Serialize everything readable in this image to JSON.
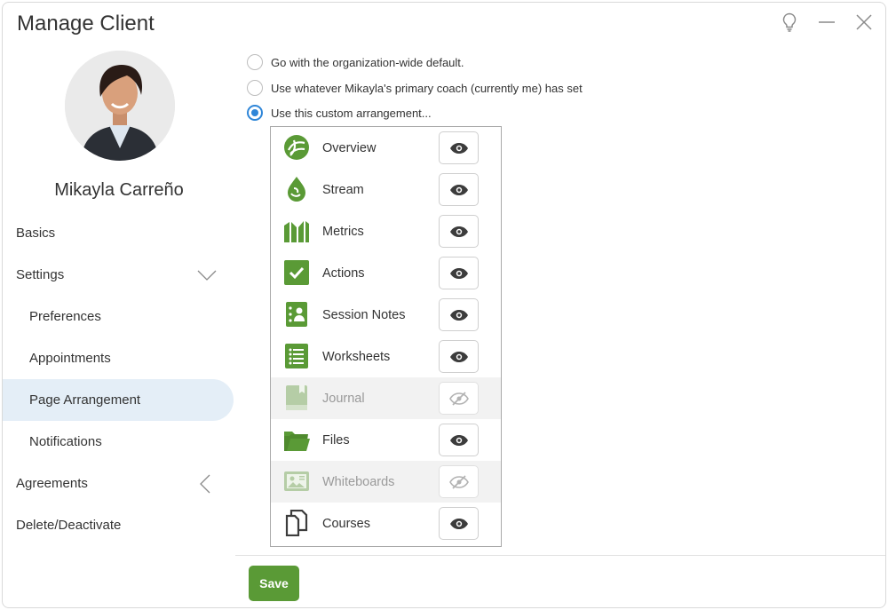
{
  "window": {
    "title": "Manage Client"
  },
  "client": {
    "name": "Mikayla Carreño"
  },
  "sidebar": {
    "items": [
      {
        "label": "Basics"
      },
      {
        "label": "Settings"
      },
      {
        "label": "Preferences"
      },
      {
        "label": "Appointments"
      },
      {
        "label": "Page Arrangement"
      },
      {
        "label": "Notifications"
      },
      {
        "label": "Agreements"
      },
      {
        "label": "Delete/Deactivate"
      }
    ],
    "active": "Page Arrangement"
  },
  "options": [
    {
      "label": "Go with the organization-wide default.",
      "checked": false
    },
    {
      "label": "Use whatever Mikayla's primary coach (currently me) has set",
      "checked": false
    },
    {
      "label": "Use this custom arrangement...",
      "checked": true
    }
  ],
  "arrangement": [
    {
      "label": "Overview",
      "icon": "overview-icon",
      "visible": true
    },
    {
      "label": "Stream",
      "icon": "stream-icon",
      "visible": true
    },
    {
      "label": "Metrics",
      "icon": "metrics-icon",
      "visible": true
    },
    {
      "label": "Actions",
      "icon": "actions-icon",
      "visible": true
    },
    {
      "label": "Session Notes",
      "icon": "session-notes-icon",
      "visible": true
    },
    {
      "label": "Worksheets",
      "icon": "worksheets-icon",
      "visible": true
    },
    {
      "label": "Journal",
      "icon": "journal-icon",
      "visible": false
    },
    {
      "label": "Files",
      "icon": "files-icon",
      "visible": true
    },
    {
      "label": "Whiteboards",
      "icon": "whiteboards-icon",
      "visible": false
    },
    {
      "label": "Courses",
      "icon": "courses-icon",
      "visible": true
    }
  ],
  "footer": {
    "save_label": "Save"
  },
  "colors": {
    "accent": "#5a9a36",
    "radio": "#2f86d8",
    "active_nav": "#e4eef7"
  }
}
